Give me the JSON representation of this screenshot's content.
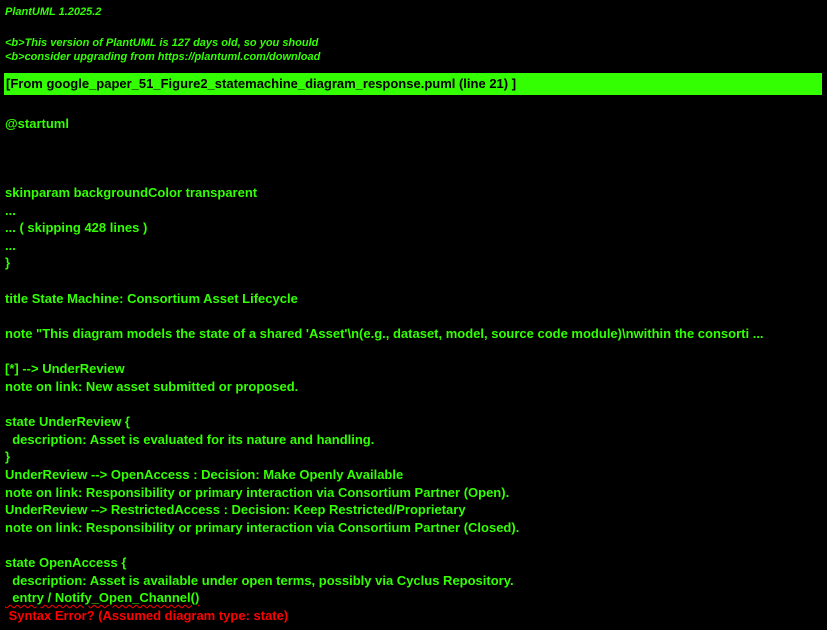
{
  "header": {
    "version": "PlantUML 1.2025.2",
    "notice_line1": "<b>This version of PlantUML is 127 days old, so you should",
    "notice_line2": "<b>consider upgrading from https://plantuml.com/download"
  },
  "banner": {
    "source": "[From google_paper_51_Figure2_statemachine_diagram_response.puml (line 21) ]"
  },
  "code": {
    "l01": "@startuml",
    "l02": "skinparam backgroundColor transparent",
    "l03": "...",
    "l04": "... ( skipping 428 lines )",
    "l05": "...",
    "l06": "}",
    "l07": "title State Machine: Consortium Asset Lifecycle",
    "l08": "note \"This diagram models the state of a shared 'Asset'\\n(e.g., dataset, model, source code module)\\nwithin the consorti ...",
    "l09": "[*] --> UnderReview",
    "l10": "note on link: New asset submitted or proposed.",
    "l11": "state UnderReview {",
    "l12": "  description: Asset is evaluated for its nature and handling.",
    "l13": "}",
    "l14": "UnderReview --> OpenAccess : Decision: Make Openly Available",
    "l15": "note on link: Responsibility or primary interaction via Consortium Partner (Open).",
    "l16": "UnderReview --> RestrictedAccess : Decision: Keep Restricted/Proprietary",
    "l17": "note on link: Responsibility or primary interaction via Consortium Partner (Closed).",
    "l18": "state OpenAccess {",
    "l19": "  description: Asset is available under open terms, possibly via Cyclus Repository.",
    "l20": "  entry / Notify_Open_Channel()"
  },
  "error": {
    "message": " Syntax Error? (Assumed diagram type: state)"
  },
  "colors": {
    "background": "#000000",
    "text": "#33ff02",
    "banner": "#33ff02",
    "error": "#ff0000"
  }
}
